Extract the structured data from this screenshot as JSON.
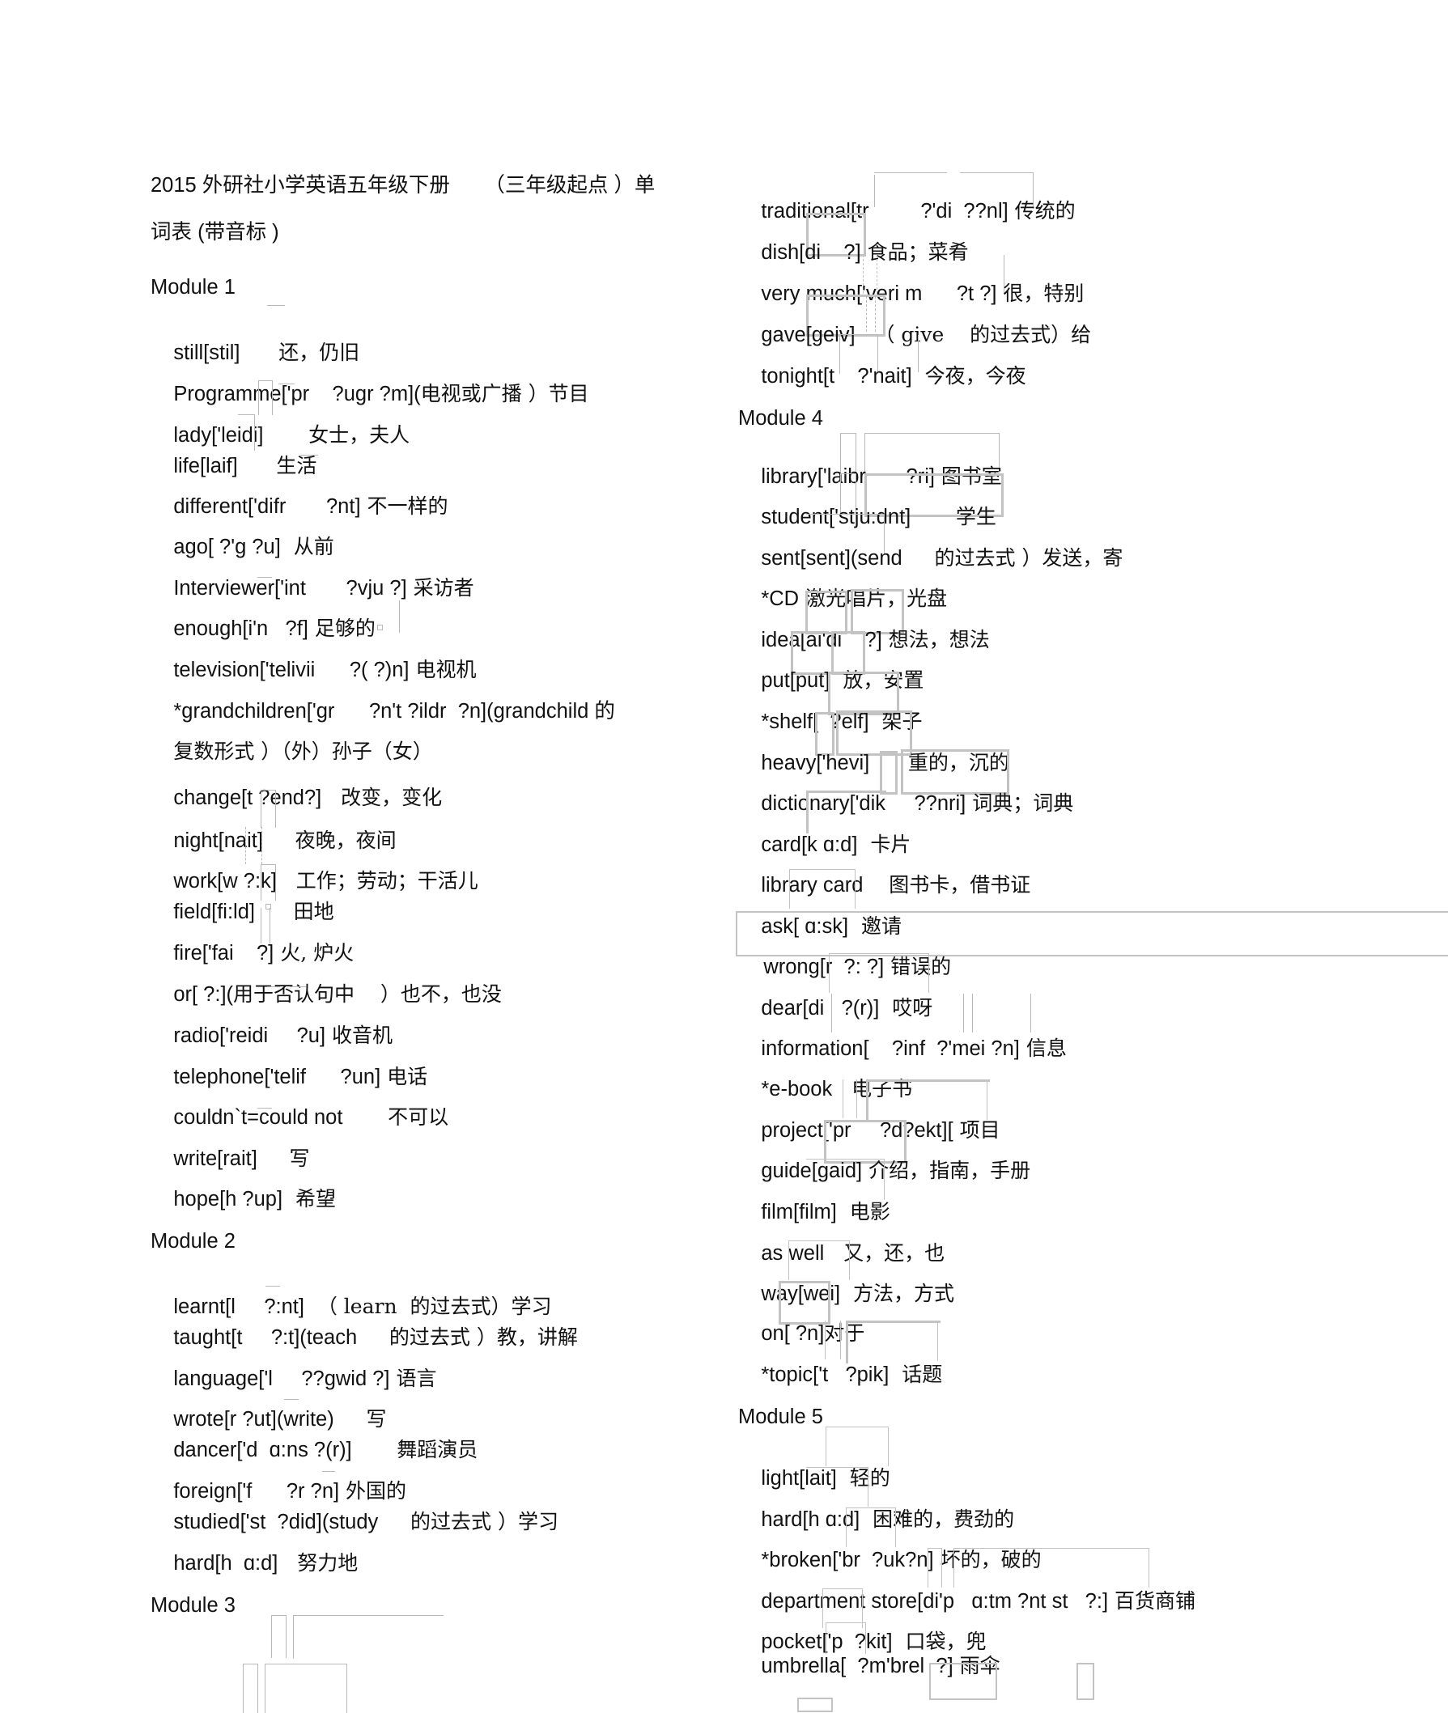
{
  "document": {
    "title_line_1": "2015 外研社小学英语五年级下册      （三年级起点 ）单",
    "title_line_2": "词表 (带音标 )"
  },
  "modules": {
    "m1": "Module 1",
    "m2": "Module 2",
    "m3": "Module 3",
    "m4": "Module 4",
    "m5": "Module 5"
  },
  "left_column": [
    {
      "word": "still[stil]",
      "gloss": "还，仍旧"
    },
    {
      "word": "Programme['pr",
      "phon": "?ugr ?m](",
      "gloss": "电视或广播 ）节目"
    },
    {
      "word": "lady['leidi]",
      "gloss": "女士，夫人"
    },
    {
      "word": "life[laif]",
      "gloss": "生活"
    },
    {
      "word": "different['difr",
      "phon": "?nt]",
      "gloss": "不一样的"
    },
    {
      "word": "ago[ ?'g ?u]",
      "gloss": "从前"
    },
    {
      "word": "Interviewer['int",
      "phon": "?vju ?]",
      "gloss": "采访者"
    },
    {
      "word": "enough[i'n",
      "phon": "?f]",
      "gloss": "足够的"
    },
    {
      "word": "television['telivii",
      "phon": "?( ?)n]",
      "gloss": "电视机"
    },
    {
      "word": "*grandchildren['gr",
      "phon": "?n't ?ildr  ?n](grandchild 的",
      "gloss": ""
    },
    {
      "word": "",
      "gloss": "复数形式 ）（外）孙子（女）"
    },
    {
      "word": "change[t ?end?]",
      "gloss": "改变，变化"
    },
    {
      "word": "night[nait]",
      "gloss": "夜晚，夜间"
    },
    {
      "word": "work[w ?:k]",
      "gloss": "工作；劳动；干活儿"
    },
    {
      "word": "field[fi:ld]",
      "gloss": "田地"
    },
    {
      "word": "fire['fai",
      "phon": "?]",
      "gloss": "火, 炉火"
    },
    {
      "word": "or[ ?:](",
      "gloss": "用于否认句中    ）也不，也没"
    },
    {
      "word": "radio['reidi",
      "phon": "?u]",
      "gloss": "收音机"
    },
    {
      "word": "telephone['telif",
      "phon": "?un]",
      "gloss": "电话"
    },
    {
      "word": "couldn`t=could not",
      "gloss": "不可以"
    },
    {
      "word": "write[rait]",
      "gloss": "写"
    },
    {
      "word": "hope[h ?up]",
      "gloss": "希望"
    },
    {
      "word": "learnt[l",
      "phon": "?:nt]",
      "gloss": "（ learn  的过去式）学习"
    },
    {
      "word": "taught[t",
      "phon": "?:t](teach",
      "gloss": "的过去式 ）教，讲解"
    },
    {
      "word": "language['l",
      "phon": "??gwid ?]",
      "gloss": "语言"
    },
    {
      "word": "wrote[r ?ut](write)",
      "gloss": "写"
    },
    {
      "word": "dancer['d  ɑ:ns ?(r)]",
      "gloss": "舞蹈演员"
    },
    {
      "word": "foreign['f",
      "phon": "?r ?n]",
      "gloss": "外国的"
    },
    {
      "word": "studied['st  ?did](study",
      "gloss": "的过去式 ）学习"
    },
    {
      "word": "hard[h  ɑ:d]",
      "gloss": "努力地"
    }
  ],
  "right_column": [
    {
      "word": "traditional[tr",
      "phon": "?'di  ??nl]",
      "gloss": "传统的"
    },
    {
      "word": "dish[di",
      "phon": "?]",
      "gloss": "食品；菜肴"
    },
    {
      "word": "very much['veri m",
      "phon": "?t ?]",
      "gloss": "很，特别"
    },
    {
      "word": "gave[geiv]",
      "gloss": "（ give    的过去式）给"
    },
    {
      "word": "tonight[t",
      "phon": "?'nait]",
      "gloss": "今夜，今夜"
    },
    {
      "word": "library['laibr",
      "phon": "?ri]",
      "gloss": "图书室"
    },
    {
      "word": "student['stju:dnt]",
      "gloss": "学生"
    },
    {
      "word": "sent[sent](send",
      "gloss": "的过去式 ）发送，寄"
    },
    {
      "word": "*CD",
      "gloss": "激光唱片，光盘"
    },
    {
      "word": "idea[ai'di",
      "phon": "?]",
      "gloss": "想法，想法"
    },
    {
      "word": "put[put]",
      "gloss": "放，安置"
    },
    {
      "word": "*shelf[",
      "phon": "?elf]",
      "gloss": "架子"
    },
    {
      "word": "heavy['hevi]",
      "gloss": "重的，沉的"
    },
    {
      "word": "dictionary['dik",
      "phon": "??nri]",
      "gloss": "词典；词典"
    },
    {
      "word": "card[k ɑ:d]",
      "gloss": "卡片"
    },
    {
      "word": "library card",
      "gloss": "图书卡，借书证"
    },
    {
      "word": "ask[ ɑ:sk]",
      "gloss": "邀请"
    },
    {
      "word": "wrong[r  ?: ?]",
      "gloss": "错误的"
    },
    {
      "word": "dear[di   ?(r)]",
      "gloss": "哎呀"
    },
    {
      "word": "information[",
      "phon": "?inf  ?'mei ?n]",
      "gloss": "信息"
    },
    {
      "word": "*e-book",
      "gloss": "电子书"
    },
    {
      "word": "project['pr",
      "phon": "?d?ekt][",
      "gloss": "项目"
    },
    {
      "word": "guide[gaid]",
      "gloss": "介绍，指南，手册"
    },
    {
      "word": "film[film]",
      "gloss": "电影"
    },
    {
      "word": "as well",
      "gloss": "又，还，也"
    },
    {
      "word": "way[wei]",
      "gloss": "方法，方式"
    },
    {
      "word": "on[ ?n]",
      "gloss": "对于"
    },
    {
      "word": "*topic['t",
      "phon": "?pik]",
      "gloss": "话题"
    },
    {
      "word": "light[lait]",
      "gloss": "轻的"
    },
    {
      "word": "hard[h ɑ:d]",
      "gloss": "困难的，费劲的"
    },
    {
      "word": "*broken['br",
      "phon": "?uk?n]",
      "gloss": "坏的，破的"
    },
    {
      "word": "department store[di'p",
      "phon": "ɑ:tm ?nt st   ?:]",
      "gloss": "百货商铺"
    },
    {
      "word": "pocket['p",
      "phon": "?kit]",
      "gloss": "口袋，兜"
    },
    {
      "word": "umbrella[",
      "phon": "?m'brel  ?]",
      "gloss": "雨伞"
    }
  ],
  "colors": {
    "text": "#111111",
    "artifact_border": "#b9b9b9",
    "background": "#ffffff"
  }
}
